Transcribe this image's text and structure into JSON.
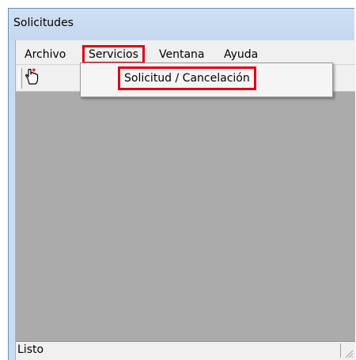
{
  "window": {
    "title": "Solicitudes"
  },
  "menubar": {
    "items": [
      {
        "label": "Archivo"
      },
      {
        "label": "Servicios",
        "highlighted": true
      },
      {
        "label": "Ventana"
      },
      {
        "label": "Ayuda"
      }
    ]
  },
  "toolbar": {
    "buttons": [
      {
        "icon": "hand-pointer-icon"
      }
    ]
  },
  "dropdown": {
    "parent": "Servicios",
    "items": [
      {
        "label": "Solicitud / Cancelación",
        "highlighted": true
      }
    ]
  },
  "statusbar": {
    "text": "Listo"
  },
  "colors": {
    "highlight": "#e3000f",
    "mdi_background": "#ababab",
    "titlebar": "#cbdcef"
  }
}
